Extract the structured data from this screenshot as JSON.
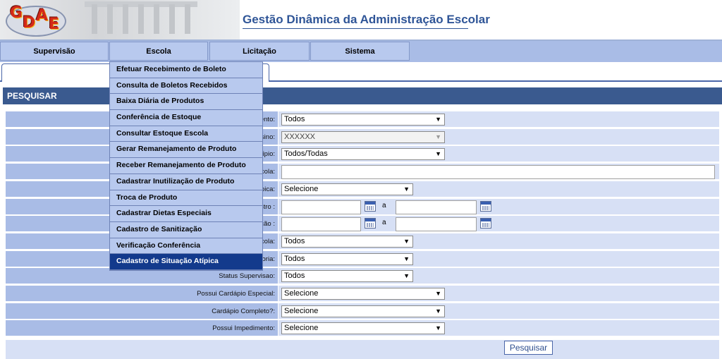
{
  "header": {
    "logo_letters": [
      "G",
      "D",
      "A",
      "E"
    ],
    "title": "Gestão Dinâmica da Administração Escolar"
  },
  "nav": {
    "items": [
      {
        "label": "Supervisão"
      },
      {
        "label": "Escola"
      },
      {
        "label": "Licitação"
      },
      {
        "label": "Sistema"
      }
    ]
  },
  "menu": {
    "items": [
      {
        "label": "Efetuar Recebimento de Boleto"
      },
      {
        "label": "Consulta de Boletos Recebidos"
      },
      {
        "label": "Baixa Diária de Produtos"
      },
      {
        "label": "Conferência de Estoque"
      },
      {
        "label": "Consultar Estoque Escola"
      },
      {
        "label": "Gerar Remanejamento de Produto"
      },
      {
        "label": "Receber Remanejamento de Produto"
      },
      {
        "label": "Cadastrar Inutilização de Produto"
      },
      {
        "label": "Troca de Produto"
      },
      {
        "label": "Cadastrar Dietas Especiais"
      },
      {
        "label": "Cadastro de Sanitização"
      },
      {
        "label": "Verificação Conferência"
      },
      {
        "label": "Cadastro de Situação Atípica"
      }
    ],
    "active_index": 12
  },
  "panel": {
    "title": "PESQUISAR"
  },
  "form": {
    "rows": [
      {
        "label": "ento:",
        "value": "Todos"
      },
      {
        "label": "nsino:",
        "value": "XXXXXX"
      },
      {
        "label": "ípio:",
        "value": "Todos/Todas"
      },
      {
        "label": "cola:",
        "value": ""
      },
      {
        "label": "ípica:",
        "value": "Selecione"
      },
      {
        "label": "stro :",
        "sep": "a"
      },
      {
        "label": "ação :",
        "sep": "a"
      },
      {
        "label": "cola:",
        "value": "Todos"
      },
      {
        "label": "toria:",
        "value": "Todos"
      },
      {
        "label": "Status Supervisao:",
        "value": "Todos"
      },
      {
        "label": "Possui Cardápio Especial:",
        "value": "Selecione"
      },
      {
        "label": "Cardápio Completo?:",
        "value": "Selecione"
      },
      {
        "label": "Possui Impedimento:",
        "value": "Selecione"
      }
    ],
    "search_button": "Pesquisar"
  },
  "colors": {
    "accent": "#2f5597",
    "panel_header": "#3a5a8f",
    "menu_active": "#133a8c",
    "label_bg": "#a9bce6",
    "value_bg": "#d7e0f5"
  }
}
